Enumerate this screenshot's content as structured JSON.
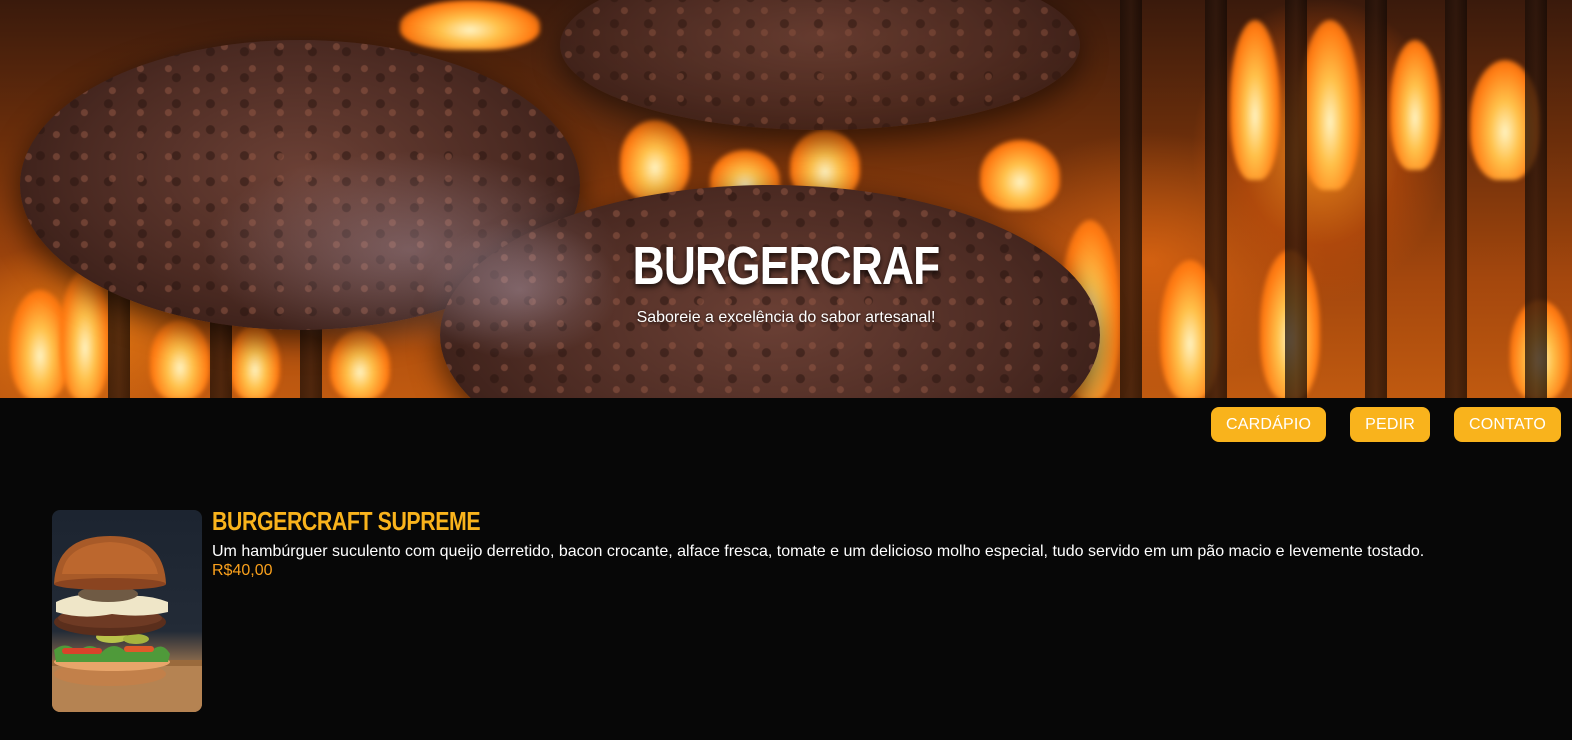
{
  "hero": {
    "title": "BURGERCRAF",
    "subtitle": "Saboreie a excelência do sabor artesanal!"
  },
  "nav": {
    "items": [
      {
        "label": "CARDÁPIO"
      },
      {
        "label": "PEDIR"
      },
      {
        "label": "CONTATO"
      }
    ]
  },
  "menu": {
    "items": [
      {
        "name": "BURGERCRAFT SUPREME",
        "description": "Um hambúrguer suculento com queijo derretido, bacon crocante, alface fresca, tomate e um delicioso molho especial, tudo servido em um pão macio e levemente tostado.",
        "price": "R$40,00"
      }
    ]
  },
  "colors": {
    "accent": "#f9b31c",
    "price": "#f9a01c",
    "background": "#070707"
  }
}
